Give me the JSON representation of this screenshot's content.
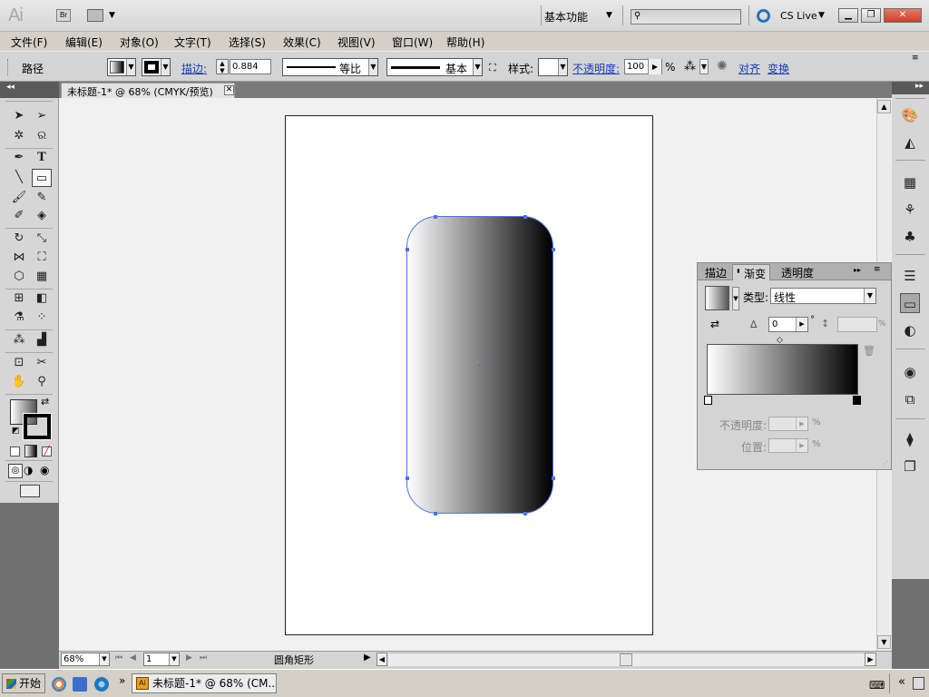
{
  "app": {
    "logo": "Ai",
    "bridge_label": "Br",
    "workspace": "基本功能",
    "cs_live": "CS Live"
  },
  "menu": [
    "文件(F)",
    "编辑(E)",
    "对象(O)",
    "文字(T)",
    "选择(S)",
    "效果(C)",
    "视图(V)",
    "窗口(W)",
    "帮助(H)"
  ],
  "control": {
    "selection_type": "路径",
    "stroke_label": "描边:",
    "stroke_weight": "0.884",
    "stroke_profile": "等比",
    "brush": "基本",
    "style_label": "样式:",
    "opacity_label": "不透明度:",
    "opacity_value": "100",
    "percent": "%",
    "align_label": "对齐",
    "transform_label": "变换"
  },
  "document": {
    "tab_title": "未标题-1* @ 68% (CMYK/预览)",
    "tab_close": "✕",
    "fill_gradient_start": "#ffffff",
    "fill_gradient_end": "#000000"
  },
  "status": {
    "zoom": "68%",
    "artboard": "1",
    "current_tool": "圆角矩形"
  },
  "gradient_panel": {
    "tabs": [
      "描边",
      "渐变",
      "透明度"
    ],
    "type_label": "类型:",
    "type_value": "线性",
    "angle_value": "0",
    "degree": "°",
    "percent": "%",
    "opacity_label": "不透明度:",
    "location_label": "位置:"
  },
  "taskbar": {
    "start": "开始",
    "task": "未标题-1* @ 68% (CM...",
    "overflow": "»",
    "task_icon": "Ai",
    "tray_collapse": "«"
  }
}
